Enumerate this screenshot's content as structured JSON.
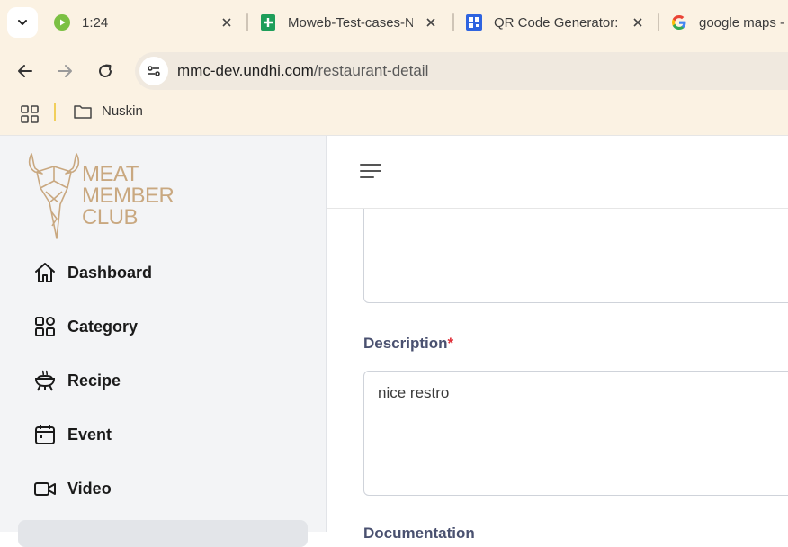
{
  "browser": {
    "tabs": [
      {
        "title": "1:24"
      },
      {
        "title": "Moweb-Test-cases-N"
      },
      {
        "title": "QR Code Generator: "
      },
      {
        "title": "google maps - "
      }
    ],
    "address": {
      "domain": "mmc-dev.undhi.com",
      "path": "/restaurant-detail"
    },
    "bookmarks": [
      {
        "label": "Nuskin"
      }
    ]
  },
  "brand": {
    "line1": "MEAT",
    "line2": "MEMBER",
    "line3": "CLUB",
    "color": "#c9a880"
  },
  "sidebar": {
    "items": [
      {
        "label": "Dashboard",
        "icon": "home-icon"
      },
      {
        "label": "Category",
        "icon": "grid-icon"
      },
      {
        "label": "Recipe",
        "icon": "grill-icon"
      },
      {
        "label": "Event",
        "icon": "calendar-icon"
      },
      {
        "label": "Video",
        "icon": "video-icon"
      }
    ]
  },
  "form": {
    "description_label": "Description",
    "required_mark": "*",
    "description_value": "nice restro",
    "next_label": "Documentation"
  }
}
